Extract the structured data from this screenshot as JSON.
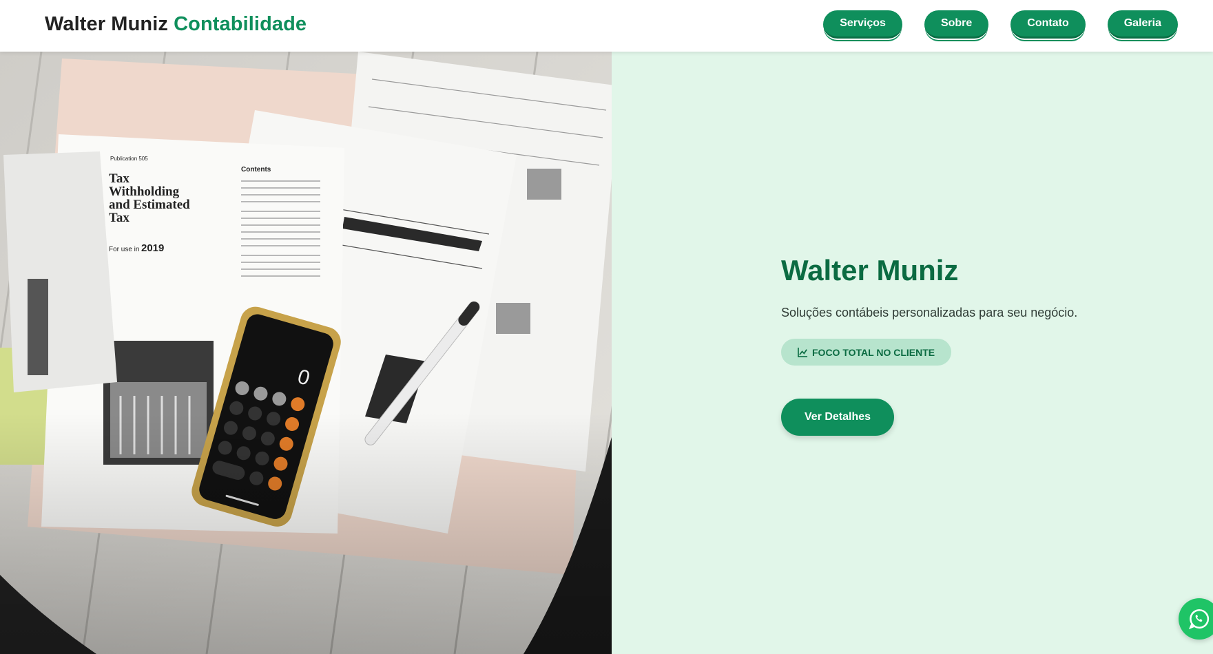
{
  "header": {
    "brand_name": "Walter Muniz",
    "brand_accent": "Contabilidade",
    "nav": [
      {
        "label": "Serviços"
      },
      {
        "label": "Sobre"
      },
      {
        "label": "Contato"
      },
      {
        "label": "Galeria"
      }
    ]
  },
  "hero": {
    "image_icon": "calculator-tax-documents-photo",
    "title": "Walter Muniz",
    "subtitle": "Soluções contábeis personalizadas para seu negócio.",
    "badge_icon": "chart-line-icon",
    "badge_label": "FOCO TOTAL NO CLIENTE",
    "cta_label": "Ver Detalhes"
  },
  "floating": {
    "icon": "whatsapp-icon"
  },
  "colors": {
    "primary": "#0f8f5c",
    "primary_dark": "#0b6b42",
    "hero_bg": "#e1f6e9",
    "badge_bg": "#b7e4cd",
    "whatsapp": "#1fc466"
  }
}
